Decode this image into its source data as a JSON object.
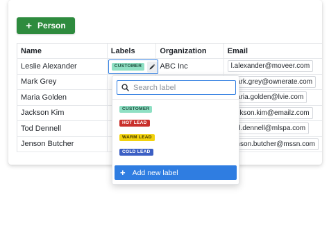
{
  "toolbar": {
    "add_person_label": "Person",
    "add_icon": "plus-icon",
    "accent": "#2e8b3e"
  },
  "table": {
    "headers": [
      "Name",
      "Labels",
      "Organization",
      "Email"
    ],
    "rows": [
      {
        "name": "Leslie Alexander",
        "label": "CUSTOMER",
        "org": "ABC Inc",
        "email": "l.alexander@moveer.com"
      },
      {
        "name": "Mark Grey",
        "email": "mark.grey@ownerate.com"
      },
      {
        "name": "Maria Golden",
        "email": "maria.golden@lvie.com"
      },
      {
        "name": "Jackson Kim",
        "email": "jackson.kim@emailz.com"
      },
      {
        "name": "Tod Dennell",
        "email": "tod.dennell@mlspa.com"
      },
      {
        "name": "Jenson Butcher",
        "email": "jenson.butcher@mssn.com"
      }
    ]
  },
  "label_dropdown": {
    "search_placeholder": "Search label",
    "options": [
      {
        "text": "CUSTOMER",
        "color": "#8fe0c4"
      },
      {
        "text": "HOT LEAD",
        "color": "#c9302c"
      },
      {
        "text": "WARM LEAD",
        "color": "#f2d20e"
      },
      {
        "text": "COLD LEAD",
        "color": "#3c5fc4"
      }
    ],
    "add_new_label": "Add new label",
    "accent": "#2f7de1"
  }
}
